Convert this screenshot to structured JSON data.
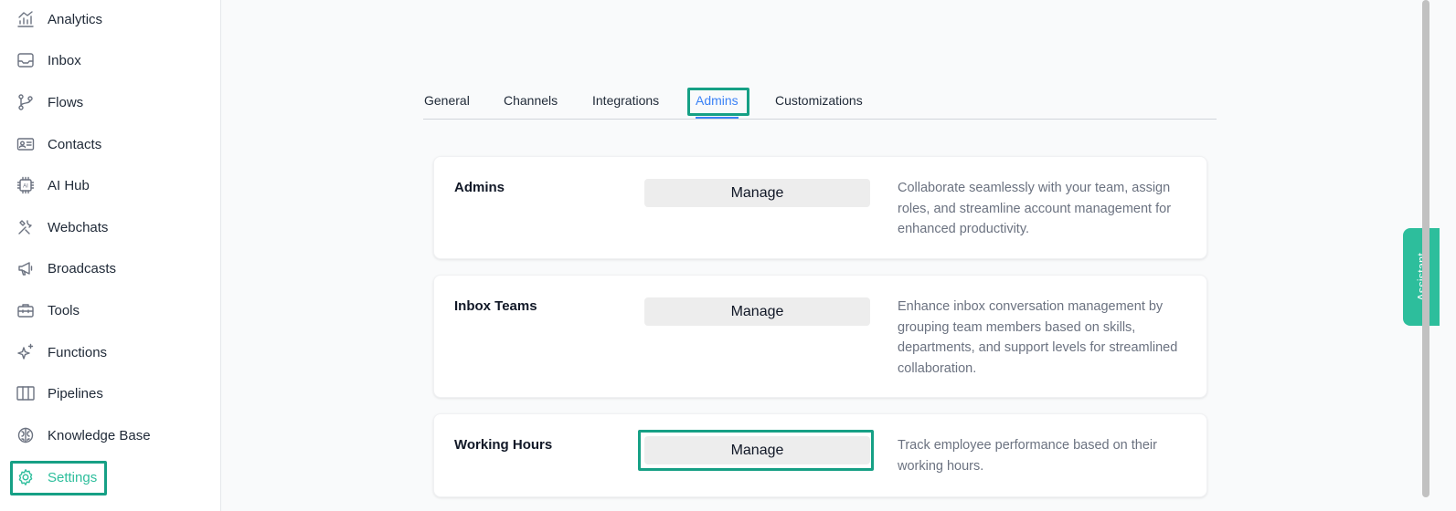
{
  "sidebar": {
    "items": [
      {
        "label": "Analytics",
        "icon": "analytics-icon"
      },
      {
        "label": "Inbox",
        "icon": "inbox-icon"
      },
      {
        "label": "Flows",
        "icon": "flows-icon"
      },
      {
        "label": "Contacts",
        "icon": "contacts-icon"
      },
      {
        "label": "AI Hub",
        "icon": "ai-hub-icon"
      },
      {
        "label": "Webchats",
        "icon": "webchats-icon"
      },
      {
        "label": "Broadcasts",
        "icon": "megaphone-icon"
      },
      {
        "label": "Tools",
        "icon": "toolbox-icon"
      },
      {
        "label": "Functions",
        "icon": "sparkle-icon"
      },
      {
        "label": "Pipelines",
        "icon": "columns-icon"
      },
      {
        "label": "Knowledge Base",
        "icon": "brain-icon"
      },
      {
        "label": "Settings",
        "icon": "gear-icon",
        "active": true
      }
    ]
  },
  "tabs": [
    {
      "label": "General"
    },
    {
      "label": "Channels"
    },
    {
      "label": "Integrations"
    },
    {
      "label": "Admins",
      "active": true
    },
    {
      "label": "Customizations"
    }
  ],
  "cards": [
    {
      "title": "Admins",
      "button_label": "Manage",
      "description": "Collaborate seamlessly with your team, assign roles, and streamline account management for enhanced productivity."
    },
    {
      "title": "Inbox Teams",
      "button_label": "Manage",
      "description": "Enhance inbox conversation management by grouping team members based on skills, departments, and support levels for streamlined collaboration."
    },
    {
      "title": "Working Hours",
      "button_label": "Manage",
      "description": "Track employee performance based on their working hours."
    }
  ],
  "assistant": {
    "label": "Assistant"
  },
  "colors": {
    "accent": "#2dbe9c",
    "active_tab": "#3b82f6",
    "highlight": "#16a085"
  }
}
